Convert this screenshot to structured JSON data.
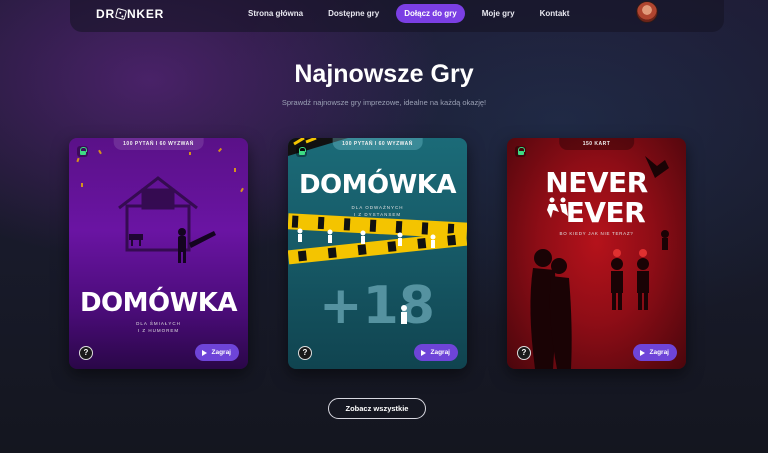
{
  "nav": {
    "logo": "DR  NKER",
    "items": [
      {
        "label": "Strona główna",
        "active": false
      },
      {
        "label": "Dostępne gry",
        "active": false
      },
      {
        "label": "Dołącz do gry",
        "active": true
      },
      {
        "label": "Moje gry",
        "active": false
      },
      {
        "label": "Kontakt",
        "active": false
      }
    ]
  },
  "main": {
    "title": "Najnowsze Gry",
    "subtitle": "Sprawdź najnowsze gry imprezowe, idealne na każdą okazję!",
    "see_all": "Zobacz wszystkie"
  },
  "cards": [
    {
      "tag": "100 PYTAŃ I 60 WYZWAŃ",
      "title": "DOMÓWKA",
      "line1": "DLA ŚMIAŁYCH",
      "line2": "I Z HUMOREM",
      "play": "Zagraj",
      "help": "?"
    },
    {
      "tag": "100 PYTAŃ I 60 WYZWAŃ",
      "title": "DOMÓWKA",
      "line1": "DLA ODWAŻNYCH",
      "line2": "I Z DYSTANSEM",
      "badge": "+18",
      "play": "Zagraj",
      "help": "?"
    },
    {
      "tag": "150 KART",
      "title1": "NEVER",
      "title2": "EVER",
      "line1": "BO KIEDY JAK NIE TERAZ?",
      "play": "Zagraj",
      "help": "?"
    }
  ],
  "colors": {
    "accent": "#7b3fe4",
    "play": "#6e44d8",
    "lock": "#3ddc84"
  }
}
